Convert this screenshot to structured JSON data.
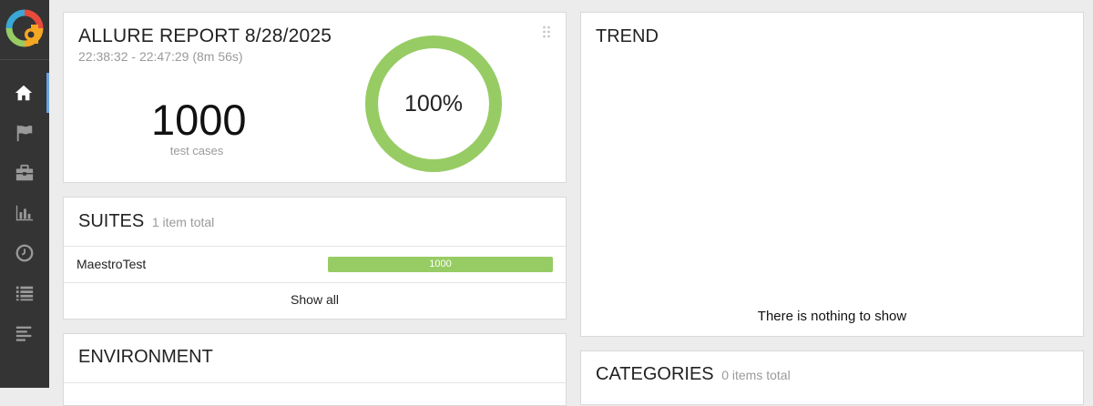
{
  "sidebar": {
    "logo": "allure-logo",
    "items": [
      {
        "icon": "home-icon",
        "active": true
      },
      {
        "icon": "flag-icon",
        "active": false
      },
      {
        "icon": "briefcase-icon",
        "active": false
      },
      {
        "icon": "bar-chart-icon",
        "active": false
      },
      {
        "icon": "clock-icon",
        "active": false
      },
      {
        "icon": "list-icon",
        "active": false
      },
      {
        "icon": "align-left-icon",
        "active": false
      }
    ],
    "active_color": "#6aa2e1"
  },
  "summary": {
    "title": "ALLURE REPORT 8/28/2025",
    "time": "22:38:32 - 22:47:29 (8m 56s)",
    "count": "1000",
    "count_label": "test cases",
    "percent_label": "100%",
    "passed_fraction": 1.0,
    "ring_color": "#97cc64"
  },
  "suites": {
    "title": "SUITES",
    "subtitle": "1 item total",
    "items": [
      {
        "name": "MaestroTest",
        "value": "1000",
        "passed_fraction": 1.0
      }
    ],
    "show_all": "Show all"
  },
  "environment": {
    "title": "ENVIRONMENT"
  },
  "trend": {
    "title": "TREND",
    "empty_message": "There is nothing to show"
  },
  "categories": {
    "title": "CATEGORIES",
    "subtitle": "0 items total"
  }
}
